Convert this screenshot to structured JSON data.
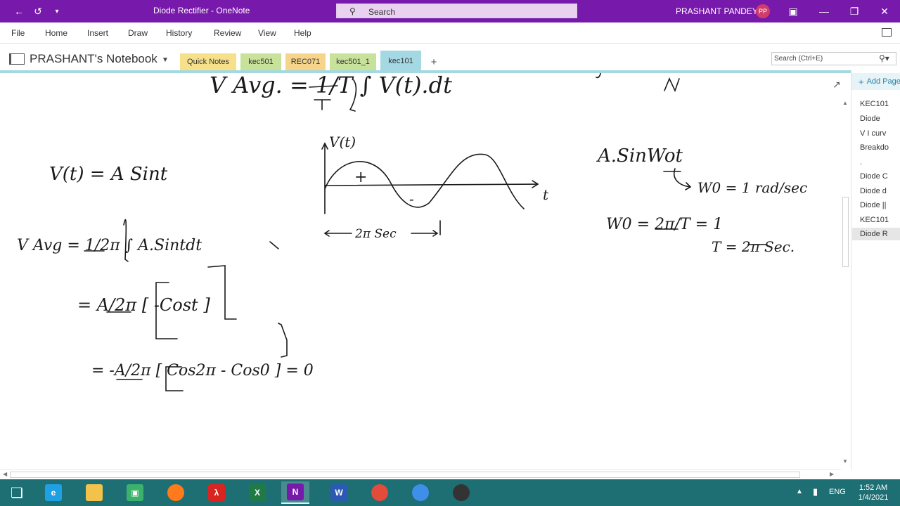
{
  "window": {
    "title": "Diode Rectifier - OneNote",
    "search_placeholder": "Search",
    "user_name": "PRASHANT PANDEY",
    "user_initials": "PP",
    "accent_color": "#7719aa"
  },
  "menu": [
    "File",
    "Home",
    "Insert",
    "Draw",
    "History",
    "Review",
    "View",
    "Help"
  ],
  "notebook": {
    "name": "PRASHANT's Notebook",
    "search_placeholder": "Search (Ctrl+E)"
  },
  "sections": [
    {
      "label": "Quick Notes",
      "color": "#f6e18a"
    },
    {
      "label": "kec501",
      "color": "#c8e29b"
    },
    {
      "label": "REC071",
      "color": "#f6d58b"
    },
    {
      "label": "kec501_1",
      "color": "#c8e29b"
    },
    {
      "label": "kec101",
      "color": "#a4d9e3",
      "active": true
    }
  ],
  "pages": {
    "add_label": "Add Page",
    "items": [
      "KEC101",
      "Diode",
      "V I curv",
      "Breakdo",
      ".",
      "Diode C",
      "Diode d",
      "Diode ||",
      "KEC101",
      "Diode R"
    ],
    "selected_index": 9
  },
  "ink": {
    "top_formula": "V Avg. = 1/T ∫ V(t).dt",
    "v_of_t": "V(t) = A Sint",
    "v_avg_line": "V Avg = 1/2π ∫ A.Sintdt",
    "step2": "= A/2π [ -Cost ]",
    "step3": "= -A/2π [ Cos2π - Cos0 ] = 0",
    "graph_y_label": "V(t)",
    "graph_x_label": "t",
    "graph_plus": "+",
    "graph_minus": "-",
    "period_label": "2π Sec",
    "sine_expr": "A.SinWot",
    "omega_val": "W0 = 1 rad/sec",
    "omega_formula": "W0 = 2π/T = 1",
    "period_result": "T = 2π Sec."
  },
  "taskbar": {
    "language": "ENG",
    "time": "1:52 AM",
    "date": "1/4/2021",
    "apps": [
      {
        "name": "windows-start",
        "color": "#ffffff"
      },
      {
        "name": "internet-explorer",
        "color": "#1fa0e4"
      },
      {
        "name": "file-explorer",
        "color": "#f2c24a"
      },
      {
        "name": "store",
        "color": "#3bb26b"
      },
      {
        "name": "firefox",
        "color": "#ff7a1a"
      },
      {
        "name": "acrobat",
        "color": "#d9241f"
      },
      {
        "name": "excel",
        "color": "#1f7a45"
      },
      {
        "name": "onenote",
        "color": "#7719aa",
        "active": true
      },
      {
        "name": "word",
        "color": "#2b5ab2"
      },
      {
        "name": "chrome",
        "color": "#e34b3a"
      },
      {
        "name": "chrome-2",
        "color": "#3f8ee8"
      },
      {
        "name": "obs",
        "color": "#333333"
      }
    ]
  }
}
